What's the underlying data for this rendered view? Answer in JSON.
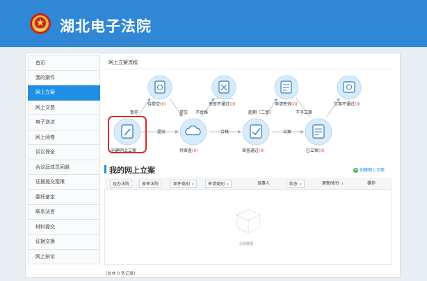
{
  "header": {
    "title": "湖北电子法院"
  },
  "sidebar": {
    "items": [
      {
        "label": "首页"
      },
      {
        "label": "我的案件"
      },
      {
        "label": "网上立案"
      },
      {
        "label": "网上交费"
      },
      {
        "label": "电子送达"
      },
      {
        "label": "网上阅卷"
      },
      {
        "label": "诉讼保全"
      },
      {
        "label": "合议庭成员回避"
      },
      {
        "label": "证据提交宽限"
      },
      {
        "label": "委托鉴定"
      },
      {
        "label": "联系法官"
      },
      {
        "label": "材料提交"
      },
      {
        "label": "证据交换"
      },
      {
        "label": "网上辩论"
      }
    ],
    "active_index": 2
  },
  "process": {
    "title": "网上立案流程",
    "nodes": {
      "pending_submit": {
        "label": "待提交",
        "count": "(0)"
      },
      "review_fail": {
        "label": "审查不通过",
        "count": "(0)"
      },
      "apply_invalid": {
        "label": "申请失效",
        "count": "(0)"
      },
      "filing_fail": {
        "label": "立案不通过",
        "count": "(0)"
      },
      "create": {
        "label": "创建网上立案"
      },
      "pending_review": {
        "label": "待审查",
        "count": "(0)"
      },
      "review_pass": {
        "label": "审查通过",
        "count": "(0)"
      },
      "filed": {
        "label": "已立案",
        "count": "(0)"
      }
    },
    "edges": {
      "save": "暂存",
      "submit_top": "提交",
      "unqualified": "不合格",
      "overdue": "超期（二审）",
      "not_accepted": "不予立案",
      "submit_mid": "提交",
      "qualified": "合格",
      "file": "立案"
    }
  },
  "my_filing": {
    "title": "我的网上立案",
    "create_link": "创建网上立案",
    "columns": {
      "court": "经办法院",
      "origin_court": "原审法院",
      "case_type": "案件类别",
      "apply_type": "申请类别",
      "party": "当事人",
      "status": "状态",
      "updated": "更新时间",
      "action": "操作"
    },
    "empty_text": "没有数据",
    "total": "(总共 0 条记录)"
  },
  "colors": {
    "header_bg": "#2f87d6",
    "active_nav": "#1f8fe6",
    "node_fill": "#d8ebfa",
    "highlight_border": "#d9262c",
    "count_red": "#d53b3b"
  }
}
